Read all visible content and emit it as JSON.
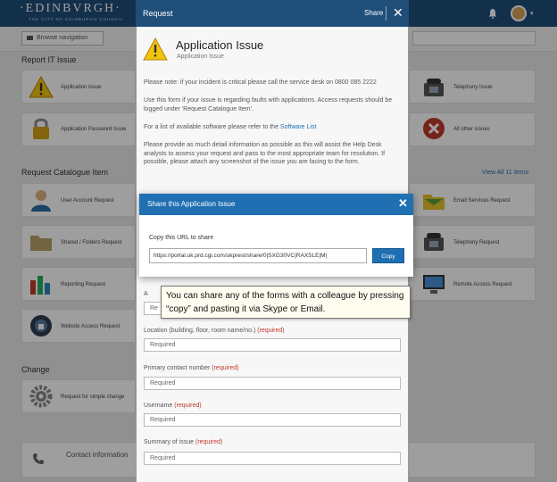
{
  "header": {
    "brand": "·EDINBVRGH·",
    "brand_sub": "THE CITY OF EDINBURGH COUNCIL"
  },
  "filterbar": {
    "nav_label": "Browse navigation"
  },
  "sections": {
    "report_it_issue": "Report IT Issue",
    "request_catalogue": "Request Catalogue Item",
    "view_all": "View All 11 items",
    "change": "Change"
  },
  "report_cards": [
    {
      "label": "Application Issue"
    },
    {
      "label": "Application Password Issue"
    },
    {
      "label": "Telephony Issue"
    },
    {
      "label": "All other issues"
    }
  ],
  "catalogue_cards": [
    {
      "label": "User Account Request"
    },
    {
      "label": "Shared / Folders Request"
    },
    {
      "label": "Reporting Request"
    },
    {
      "label": "Website Access Request"
    },
    {
      "label": "Email Services Request"
    },
    {
      "label": "Telephony Request"
    },
    {
      "label": "Remote Access Request"
    }
  ],
  "change_cards": [
    {
      "label": "Request for simple change"
    }
  ],
  "contact": {
    "label": "Contact information"
  },
  "panel": {
    "title": "Request",
    "share": "Share",
    "issue_title": "Application Issue",
    "issue_sub": "Application Issue",
    "para1": "Please note: if your incident is critical please call the service desk on 0800 085 2222",
    "para2": "Use this form if your issue is regarding faults with applications. Access requests should be logged under 'Request Catalogue Item'.",
    "para3_pre": "For a list of available software please refer to the",
    "para3_link": "Software List",
    "para4": "Please provide as much detail information as possible as this will assist the Help Desk analysts to assess your request and pass to the most appropriate team for resolution. If possible, please attach any screenshot of the issue you are facing to the form.",
    "fields": [
      {
        "label": "Location (building, floor, room name/no.)",
        "required": "(required)",
        "placeholder": "Required"
      },
      {
        "label": "Primary contact number",
        "required": "(required)",
        "placeholder": "Required"
      },
      {
        "label": "Username",
        "required": "(required)",
        "placeholder": "Required"
      },
      {
        "label": "Summary of issue",
        "required": "(required)",
        "placeholder": "Required"
      }
    ],
    "partial_label": "A",
    "partial_field": "Re"
  },
  "share_modal": {
    "title": "Share this Application Issue",
    "label": "Copy this URL to share",
    "url": "https://portal.uk.prd.cgi.com/ukprest/share/0|SXG30VC|RAXSLE|M|",
    "copy": "Copy"
  },
  "callout": {
    "text": "You can share any of the forms with a colleague by pressing “copy” and pasting it via Skype or Email."
  },
  "colors": {
    "brand": "#1f4e79",
    "accent": "#1f6fb2",
    "required": "#c0392b"
  }
}
